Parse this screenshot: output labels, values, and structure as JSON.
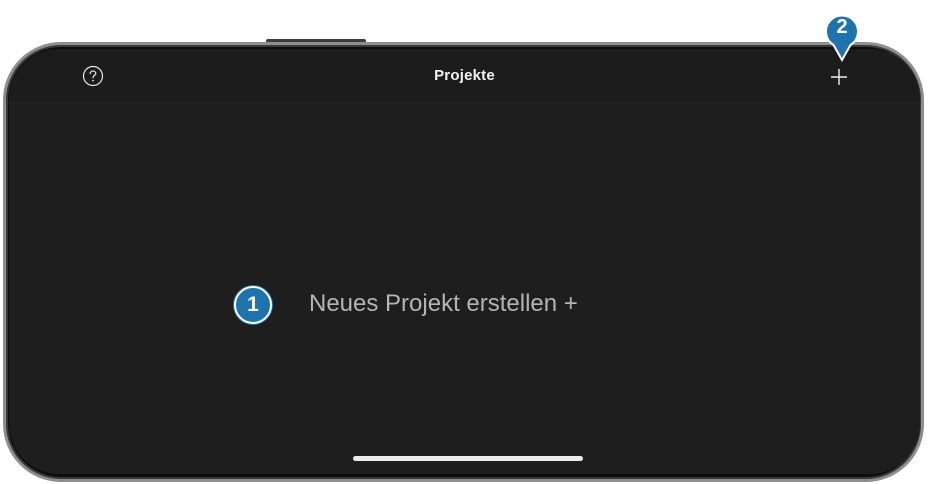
{
  "navbar": {
    "title": "Projekte",
    "help_icon": "question-circle-icon",
    "add_icon": "plus-icon"
  },
  "empty_state": {
    "create_label": "Neues Projekt erstellen +"
  },
  "annotations": {
    "marker_1": "1",
    "marker_2": "2",
    "marker_color": "#1f73ad"
  },
  "colors": {
    "screen_bg": "#1e1e1e",
    "navbar_bg": "#1c1c1d",
    "title_text": "#f2f2f2",
    "secondary_text": "#b4b4b4"
  }
}
